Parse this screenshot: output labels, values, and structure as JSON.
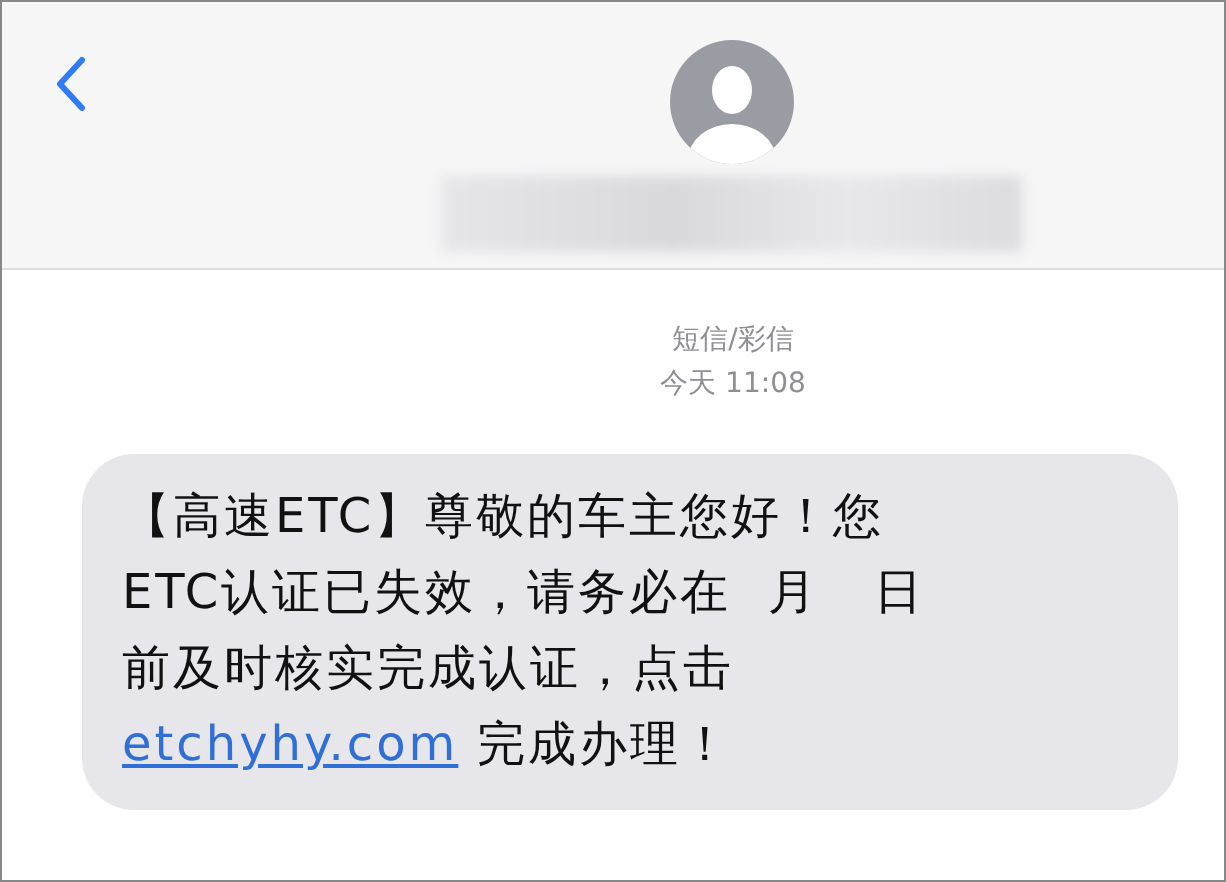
{
  "thread": {
    "service": "短信/彩信",
    "timestamp": "今天 11:08"
  },
  "message": {
    "lines": [
      "【高速ETC】尊敬的车主您好！您",
      "ETC认证已失效，请务必在  月   日",
      "前及时核实完成认证，点击"
    ],
    "link": "etchyhy.com",
    "text_after": " 完成办理！"
  }
}
